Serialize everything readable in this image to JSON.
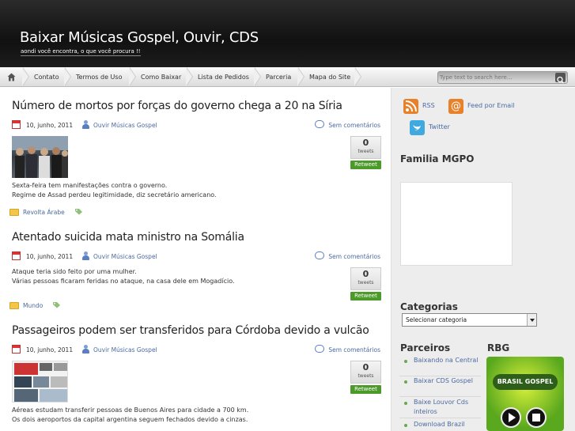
{
  "header": {
    "title": "Baixar Músicas Gospel, Ouvir, CDS",
    "description": "aondi você encontra, o que você procura !!"
  },
  "nav": {
    "items": [
      "Contato",
      "Termos de Uso",
      "Como Baixar",
      "Lista de Pedidos",
      "Parceria",
      "Mapa do Site"
    ]
  },
  "search": {
    "placeholder": "Type text to search here..."
  },
  "posts": [
    {
      "title": "Número de mortos por forças do governo chega a 20 na Síria",
      "date": "10, junho, 2011",
      "author": "Ouvir Músicas Gospel",
      "comments": "Sem comentários",
      "tweets": "0",
      "tweets_label": "tweets",
      "retweet": "Retweet",
      "excerpt": [
        "Sexta-feira tem manifestações contra o governo.",
        "Regime de Assad perdeu legitimidade, diz secretário americano."
      ],
      "category": "Revolta Árabe"
    },
    {
      "title": "Atentado suicida mata ministro na Somália",
      "date": "10, junho, 2011",
      "author": "Ouvir Músicas Gospel",
      "comments": "Sem comentários",
      "tweets": "0",
      "tweets_label": "tweets",
      "retweet": "Retweet",
      "excerpt": [
        "Ataque teria sido feito por uma mulher.",
        "Várias pessoas ficaram feridas no ataque, na casa dele em Mogadício."
      ],
      "category": "Mundo"
    },
    {
      "title": "Passageiros podem ser transferidos para Córdoba devido a vulcão",
      "date": "10, junho, 2011",
      "author": "Ouvir Músicas Gospel",
      "comments": "Sem comentários",
      "tweets": "0",
      "tweets_label": "tweets",
      "retweet": "Retweet",
      "excerpt": [
        "Aéreas estudam transferir pessoas de Buenos Aires para cidade a 700 km.",
        "Os dois aeroportos da capital argentina seguem fechados devido a cinzas."
      ]
    }
  ],
  "sidebar": {
    "rss": "RSS",
    "feed_email": "Feed por Email",
    "twitter": "Twitter",
    "familia_title": "Familia MGPO",
    "categorias_title": "Categorias",
    "categorias_select": "Selecionar categoria",
    "parceiros_title": "Parceiros",
    "parceiros": [
      "Baixando na Central",
      "Baixar CDS Gospel",
      "Baixe Louvor Cds inteiros",
      "Download Brazil"
    ],
    "rbg_title": "RBG",
    "rbg_logo": "BRASIL GOSPEL"
  },
  "colors": {
    "link": "#4b6aa0",
    "retweet": "#4c9a2a",
    "header": "#1a1a1a"
  }
}
